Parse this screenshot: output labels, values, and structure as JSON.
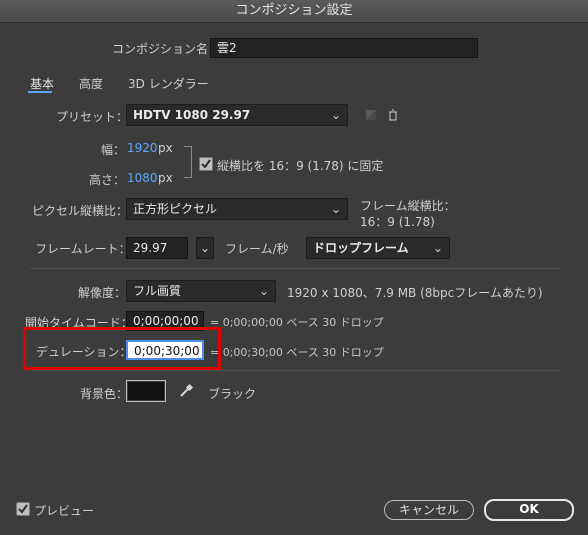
{
  "window": {
    "title": "コンポジション設定"
  },
  "composition_name": {
    "label": "コンポジション名：",
    "value": "雲2"
  },
  "tabs": [
    {
      "label": "基本",
      "active": true
    },
    {
      "label": "高度",
      "active": false
    },
    {
      "label": "3D レンダラー",
      "active": false
    }
  ],
  "preset": {
    "label": "プリセット：",
    "value": "HDTV 1080 29.97"
  },
  "width": {
    "label": "幅：",
    "value": "1920",
    "unit": "px"
  },
  "height": {
    "label": "高さ：",
    "value": "1080",
    "unit": "px"
  },
  "lock_aspect": {
    "checked": true,
    "label": "縦横比を 16：9 (1.78) に固定"
  },
  "pixel_aspect": {
    "label": "ピクセル縦横比：",
    "value": "正方形ピクセル"
  },
  "frame_aspect": {
    "label": "フレーム縦横比：",
    "value": "16：9 (1.78)"
  },
  "frame_rate": {
    "label": "フレームレート：",
    "value": "29.97",
    "unit_label": "フレーム/秒",
    "mode": "ドロップフレーム"
  },
  "resolution": {
    "label": "解像度：",
    "value": "フル画質",
    "info": "1920 x 1080、7.9 MB (8bpcフレームあたり)"
  },
  "start_timecode": {
    "label": "開始タイムコード：",
    "value": "0;00;00;00",
    "info": "= 0;00;00;00  ベース 30  ドロップ"
  },
  "duration": {
    "label": "デュレーション：",
    "value": "0;00;30;00",
    "info": "= 0;00;30;00  ベース 30  ドロップ"
  },
  "background": {
    "label": "背景色：",
    "color": "#111111",
    "name": "ブラック"
  },
  "preview": {
    "checked": true,
    "label": "プレビュー"
  },
  "buttons": {
    "cancel": "キャンセル",
    "ok": "OK"
  },
  "colors": {
    "accent_blue": "#5aa6ff",
    "highlight_red": "#e10000"
  }
}
